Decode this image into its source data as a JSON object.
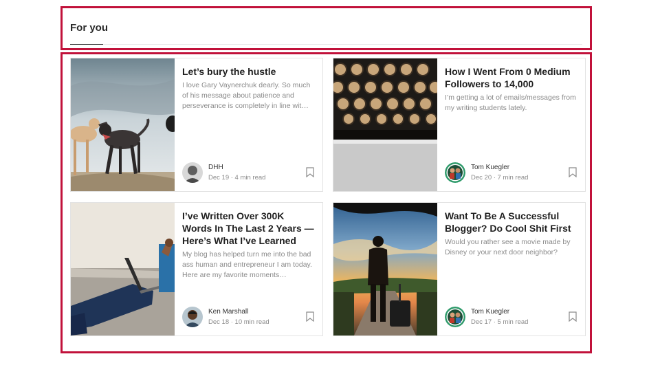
{
  "feed": {
    "tab_label": "For you"
  },
  "articles": [
    {
      "title": "Let’s bury the hustle",
      "excerpt": "I love Gary Vaynerchuk dearly. So much of his message about patience and perseverance is completely in line wit…",
      "author": "DHH",
      "date_read": "Dec 19 · 4 min read",
      "thumbnail_icon": "dogs-photo",
      "avatar_icon": "author-avatar"
    },
    {
      "title": "How I Went From 0 Medium Followers to 14,000",
      "excerpt": "I’m getting a lot of emails/messages from my writing students lately.",
      "author": "Tom Kuegler",
      "date_read": "Dec 20 · 7 min read",
      "thumbnail_icon": "typewriter-photo",
      "avatar_icon": "author-avatar"
    },
    {
      "title": "I’ve Written Over 300K Words In The Last 2 Years — Here’s What I’ve Learned",
      "excerpt": "My blog has helped turn me into the bad ass human and entrepreneur I am today. Here are my favorite moments…",
      "author": "Ken Marshall",
      "date_read": "Dec 18 · 10 min read",
      "thumbnail_icon": "laptop-photo",
      "avatar_icon": "author-avatar"
    },
    {
      "title": "Want To Be A Successful Blogger? Do Cool Shit First",
      "excerpt": "Would you rather see a movie made by Disney or your next door neighbor?",
      "author": "Tom Kuegler",
      "date_read": "Dec 17 · 5 min read",
      "thumbnail_icon": "traveler-sunset-photo",
      "avatar_icon": "author-avatar"
    }
  ],
  "colors": {
    "highlight_border": "#c1113a",
    "title_text": "#1f1f1f",
    "muted_text": "#8a8a8a"
  }
}
